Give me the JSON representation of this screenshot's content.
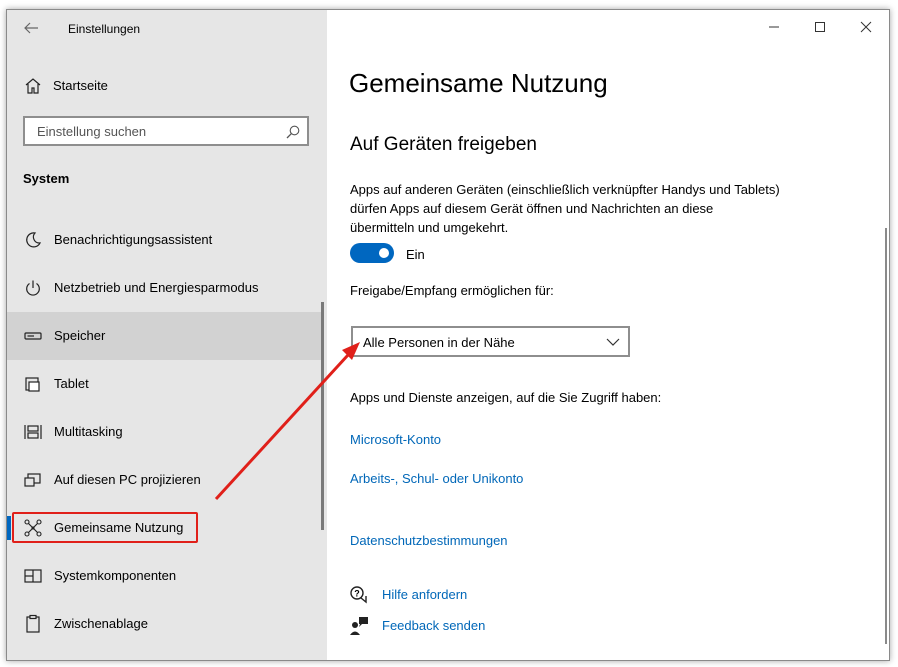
{
  "window": {
    "title": "Einstellungen"
  },
  "sidebar": {
    "home_label": "Startseite",
    "search_placeholder": "Einstellung suchen",
    "section": "System",
    "items": [
      {
        "label": "Benachrichtigungsassistent",
        "icon": "moon-icon"
      },
      {
        "label": "Netzbetrieb und Energiesparmodus",
        "icon": "power-icon"
      },
      {
        "label": "Speicher",
        "icon": "storage-icon"
      },
      {
        "label": "Tablet",
        "icon": "tablet-icon"
      },
      {
        "label": "Multitasking",
        "icon": "multitasking-icon"
      },
      {
        "label": "Auf diesen PC projizieren",
        "icon": "project-icon"
      },
      {
        "label": "Gemeinsame Nutzung",
        "icon": "share-icon"
      },
      {
        "label": "Systemkomponenten",
        "icon": "components-icon"
      },
      {
        "label": "Zwischenablage",
        "icon": "clipboard-icon"
      }
    ]
  },
  "main": {
    "title": "Gemeinsame Nutzung",
    "subtitle": "Auf Geräten freigeben",
    "description": "Apps auf anderen Geräten (einschließlich verknüpfter Handys und Tablets) dürfen Apps auf diesem Gerät öffnen und Nachrichten an diese übermitteln und umgekehrt.",
    "toggle_state": "Ein",
    "share_label": "Freigabe/Empfang ermöglichen für:",
    "share_value": "Alle Personen in der Nähe",
    "apps_label": "Apps und Dienste anzeigen, auf die Sie Zugriff haben:",
    "links": [
      "Microsoft-Konto",
      "Arbeits-, Schul- oder Unikonto",
      "Datenschutzbestimmungen"
    ],
    "help": "Hilfe anfordern",
    "feedback": "Feedback senden"
  },
  "colors": {
    "accent": "#0067c0",
    "link": "#0067b8",
    "annotation": "#e0201a",
    "sidebar_bg": "#e6e6e6"
  }
}
